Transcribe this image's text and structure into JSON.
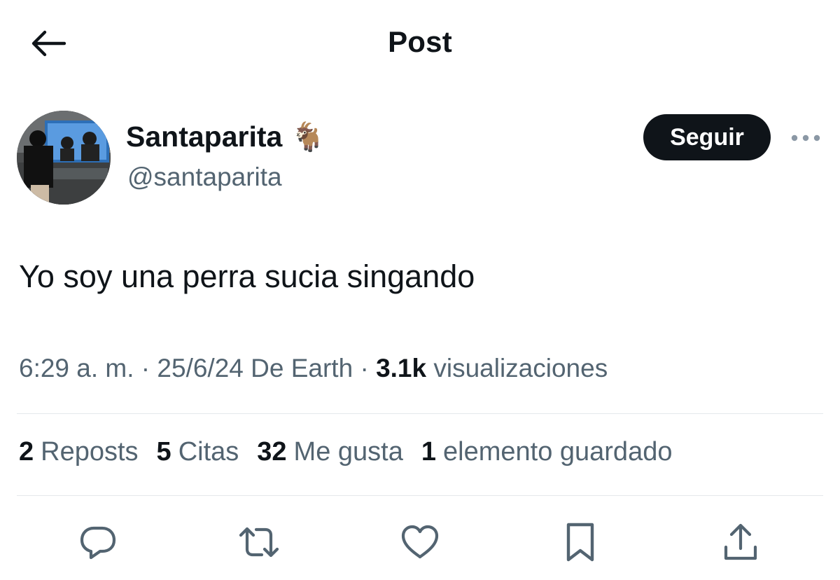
{
  "header": {
    "title": "Post",
    "back_icon": "arrow-left-icon"
  },
  "author": {
    "display_name": "Santaparita",
    "name_emoji": "🐐",
    "handle": "@santaparita",
    "follow_label": "Seguir",
    "more_icon": "ellipsis-icon"
  },
  "post": {
    "text": "Yo soy una perra sucia singando"
  },
  "meta": {
    "time": "6:29 a. m.",
    "date": "25/6/24",
    "source": "De Earth",
    "views_count": "3.1k",
    "views_label": "visualizaciones"
  },
  "stats": [
    {
      "count": "2",
      "label": "Reposts"
    },
    {
      "count": "5",
      "label": "Citas"
    },
    {
      "count": "32",
      "label": "Me gusta"
    },
    {
      "count": "1",
      "label": "elemento guardado"
    }
  ],
  "actions": [
    {
      "icon": "reply-icon"
    },
    {
      "icon": "repost-icon"
    },
    {
      "icon": "like-icon"
    },
    {
      "icon": "bookmark-icon"
    },
    {
      "icon": "share-icon"
    }
  ],
  "colors": {
    "text_primary": "#0f1419",
    "text_secondary": "#536471",
    "divider": "#e4e8eb",
    "follow_button_bg": "#0f1419"
  }
}
